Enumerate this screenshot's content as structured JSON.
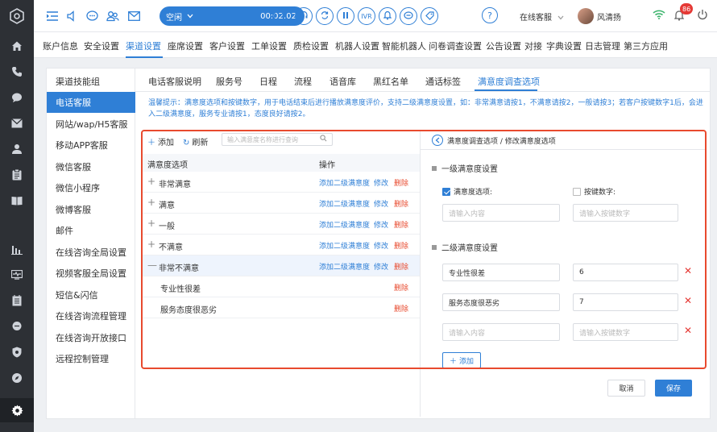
{
  "topbar": {
    "status": "空闲",
    "timer": "00:02:02",
    "controls": [
      "phone-hangup-icon",
      "headset-icon",
      "transfer-icon",
      "pause-icon",
      "IVR",
      "bell-icon",
      "chat-icon",
      "tag-icon"
    ],
    "ivr_label": "IVR",
    "help": "?",
    "online_status": "在线客服",
    "user_name": "风清扬",
    "badge_count": "86"
  },
  "nav": {
    "items": [
      "账户信息",
      "安全设置",
      "渠道设置",
      "座席设置",
      "客户设置",
      "工单设置",
      "质检设置",
      "机器人设置",
      "智能机器人",
      "问卷调查设置",
      "公告设置",
      "对接",
      "字典设置",
      "日志管理",
      "第三方应用"
    ],
    "active_index": 2
  },
  "sidebar": {
    "items": [
      "渠道技能组",
      "电话客服",
      "网站/wap/H5客服",
      "移动APP客服",
      "微信客服",
      "微信小程序",
      "微博客服",
      "邮件",
      "在线咨询全局设置",
      "视频客服全局设置",
      "短信&闪信",
      "在线咨询流程管理",
      "在线咨询开放接口",
      "远程控制管理"
    ],
    "active_index": 1
  },
  "subtabs": {
    "items": [
      "电话客服说明",
      "服务号",
      "日程",
      "流程",
      "语音库",
      "黑红名单",
      "通话标签",
      "满意度调查选项"
    ],
    "active_index": 7
  },
  "tip": "温馨提示：满意度选项和按键数字，用于电话结束后进行播放满意度评价，支持二级满意度设置，如：非常满意请按1，不满意请按2，一般请按3；若客户按键数字1后，会进入二级满意度，服务专业请按1，态度良好请按2。",
  "left": {
    "add": "添加",
    "refresh": "刷新",
    "search_placeholder": "输入满意度名称进行查询",
    "col_option": "满意度选项",
    "col_action": "操作",
    "action_add_sub": "添加二级满意度",
    "action_edit": "修改",
    "action_delete": "删除",
    "rows": [
      {
        "name": "非常满意",
        "expander": "+"
      },
      {
        "name": "满意",
        "expander": "+"
      },
      {
        "name": "一般",
        "expander": "+"
      },
      {
        "name": "不满意",
        "expander": "+"
      },
      {
        "name": "非常不满意",
        "expander": "—"
      },
      {
        "name": "专业性很差",
        "child": true
      },
      {
        "name": "服务态度很恶劣",
        "child": true
      }
    ]
  },
  "right": {
    "breadcrumb": "满意度调查选项 / 修改满意度选项",
    "level1_title": "一级满意度设置",
    "cb_option": "满意度选项:",
    "cb_key": "按键数字:",
    "ph_content": "请输入内容",
    "ph_key": "请输入按键数字",
    "level2_title": "二级满意度设置",
    "level2_rows": [
      {
        "option": "专业性很差",
        "key": "6"
      },
      {
        "option": "服务态度很恶劣",
        "key": "7"
      }
    ],
    "add_label": "添加"
  },
  "footer": {
    "cancel": "取消",
    "save": "保存"
  }
}
